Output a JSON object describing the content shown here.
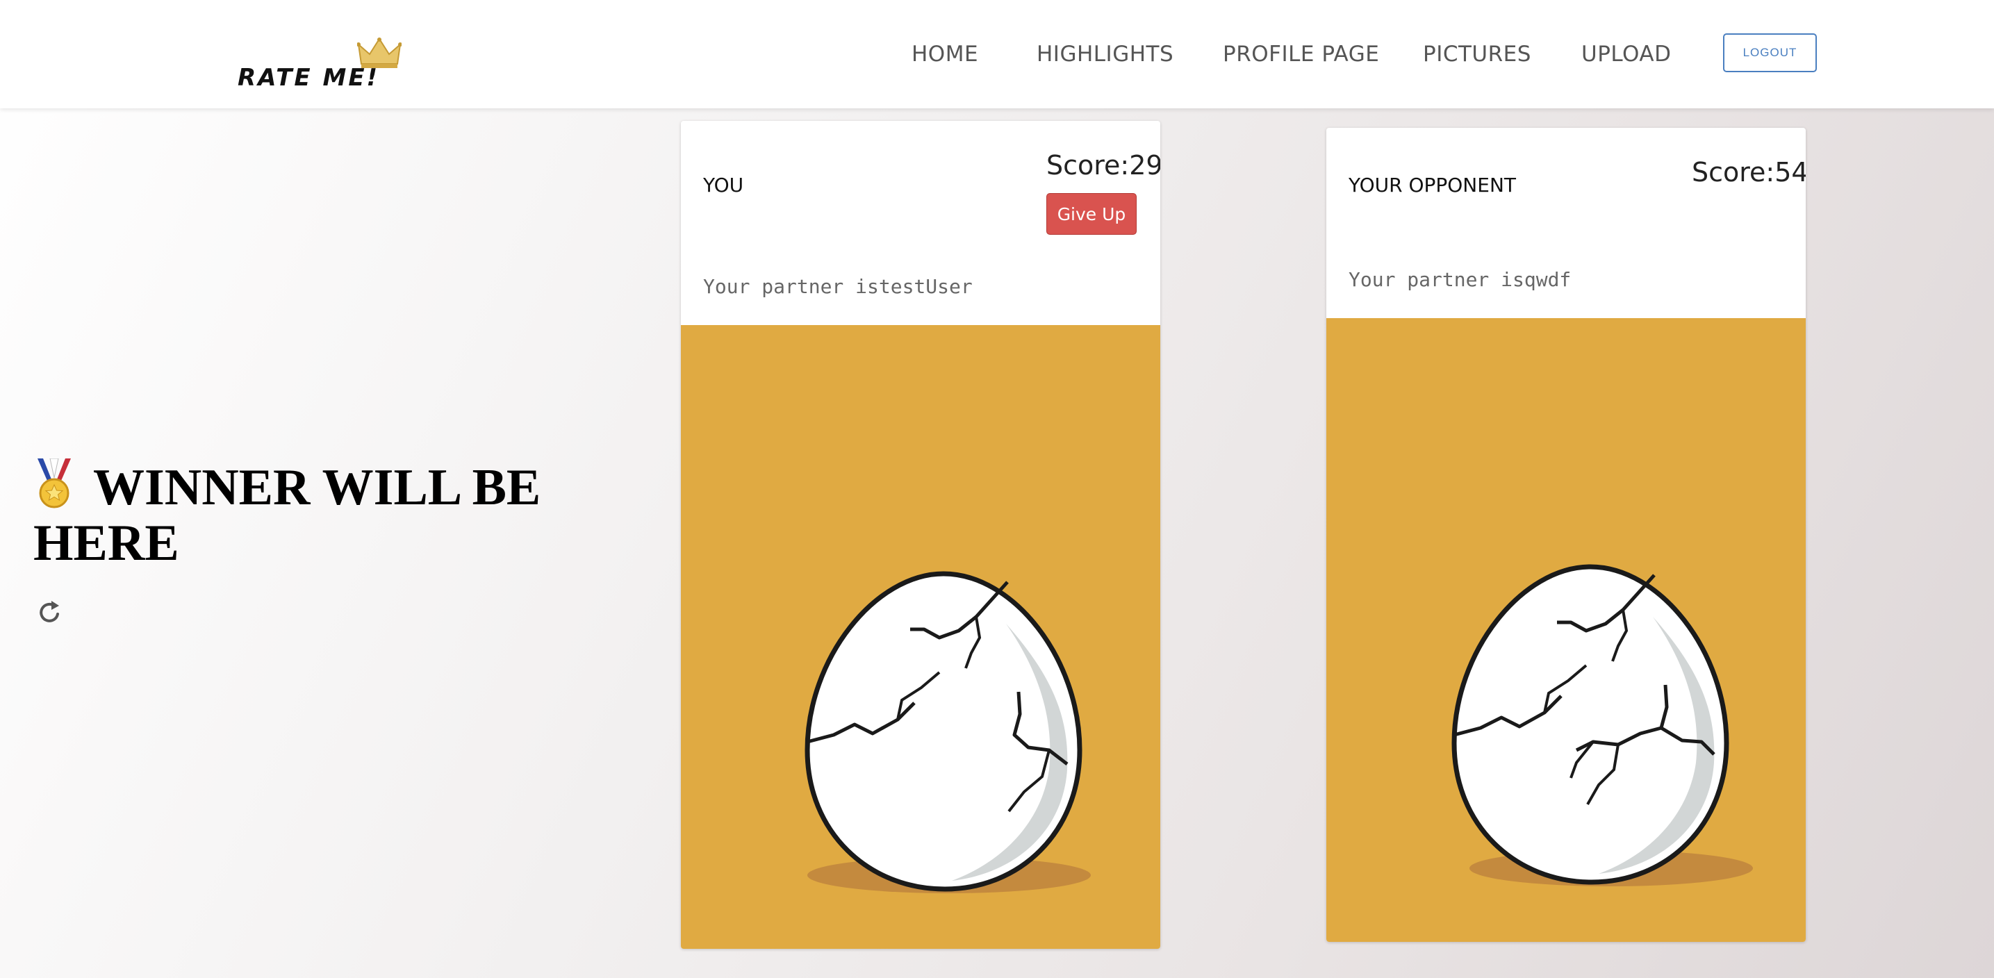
{
  "navbar": {
    "logo_text": "RATE ME!",
    "links": [
      "HOME",
      "HIGHLIGHTS",
      "PROFILE PAGE",
      "PICTURES",
      "UPLOAD"
    ],
    "logout_label": "LOGOUT"
  },
  "winner": {
    "text": "WINNER WILL BE HERE",
    "icon": "medal-icon",
    "refresh_icon": "refresh-icon"
  },
  "cards": {
    "you": {
      "title": "YOU",
      "score_label": "Score:29",
      "give_up_label": "Give Up",
      "partner_text": "Your partner istestUser",
      "image": "cracked-egg"
    },
    "opponent": {
      "title": "YOUR OPPONENT",
      "score_label": "Score:54",
      "partner_text": "Your partner isqwdf",
      "image": "cracked-egg"
    }
  },
  "colors": {
    "image_background": "#e0aa42",
    "give_up": "#d9534f",
    "logout_accent": "#4a7fc0"
  }
}
